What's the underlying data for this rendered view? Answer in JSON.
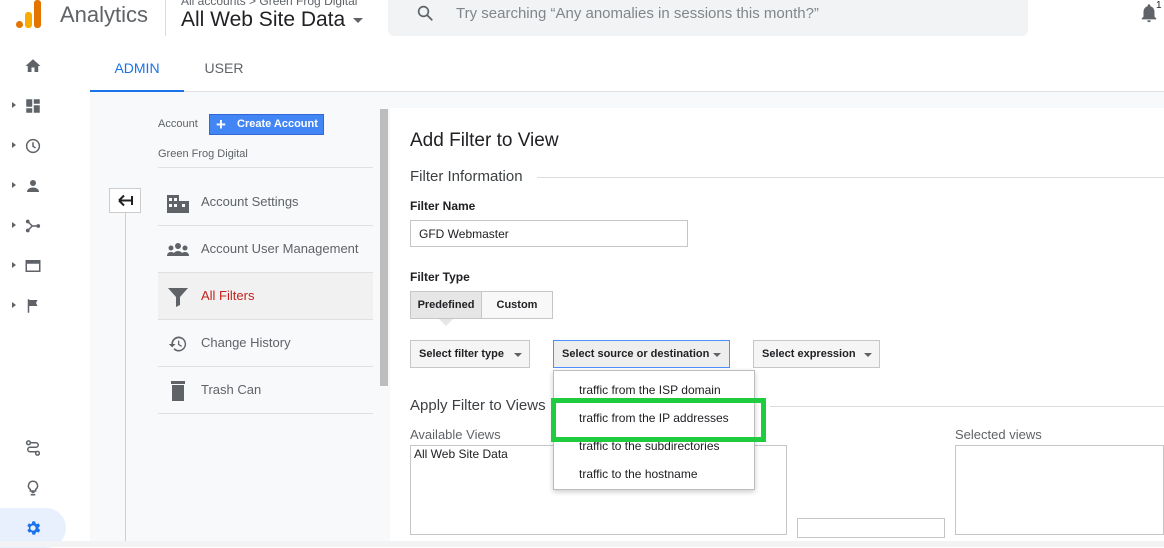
{
  "header": {
    "app_name": "Analytics",
    "breadcrumb": "All accounts > Green Frog Digital",
    "property": "All Web Site Data",
    "search_placeholder": "Try searching “Any anomalies in sessions this month?”",
    "notification_count": "1"
  },
  "rail": {
    "items": [
      "home-icon",
      "dashboard-icon",
      "clock-icon",
      "person-icon",
      "acquisition-icon",
      "behavior-icon",
      "flag-icon"
    ],
    "bottom": [
      "route-icon",
      "lightbulb-icon",
      "gear-icon"
    ]
  },
  "tabs": [
    {
      "label": "ADMIN",
      "active": true
    },
    {
      "label": "USER",
      "active": false
    }
  ],
  "account": {
    "label": "Account",
    "create_button": "Create Account",
    "name": "Green Frog Digital",
    "menu": [
      {
        "label": "Account Settings",
        "icon": "building-icon"
      },
      {
        "label": "Account User Management",
        "icon": "people-icon"
      },
      {
        "label": "All Filters",
        "icon": "filter-icon",
        "active": true
      },
      {
        "label": "Change History",
        "icon": "history-icon"
      },
      {
        "label": "Trash Can",
        "icon": "trash-icon"
      }
    ]
  },
  "form": {
    "title": "Add Filter to View",
    "section_info": "Filter Information",
    "filter_name_label": "Filter Name",
    "filter_name_value": "GFD Webmaster",
    "filter_type_label": "Filter Type",
    "type_predefined": "Predefined",
    "type_custom": "Custom",
    "select_filter_type": "Select filter type",
    "select_source": "Select source or destination",
    "select_expression": "Select expression",
    "apply_title": "Apply Filter to Views",
    "available_views_label": "Available Views",
    "available_views": [
      "All Web Site Data"
    ],
    "selected_views_label": "Selected views"
  },
  "dropdown": {
    "options": [
      "traffic from the ISP domain",
      "traffic from the IP addresses",
      "traffic to the subdirectories",
      "traffic to the hostname"
    ],
    "highlighted_index": 1,
    "highlight_color": "#1fcc3f"
  },
  "colors": {
    "accent": "#1a73e8",
    "active_filter": "#c5221f",
    "create_button": "#4285f4"
  }
}
